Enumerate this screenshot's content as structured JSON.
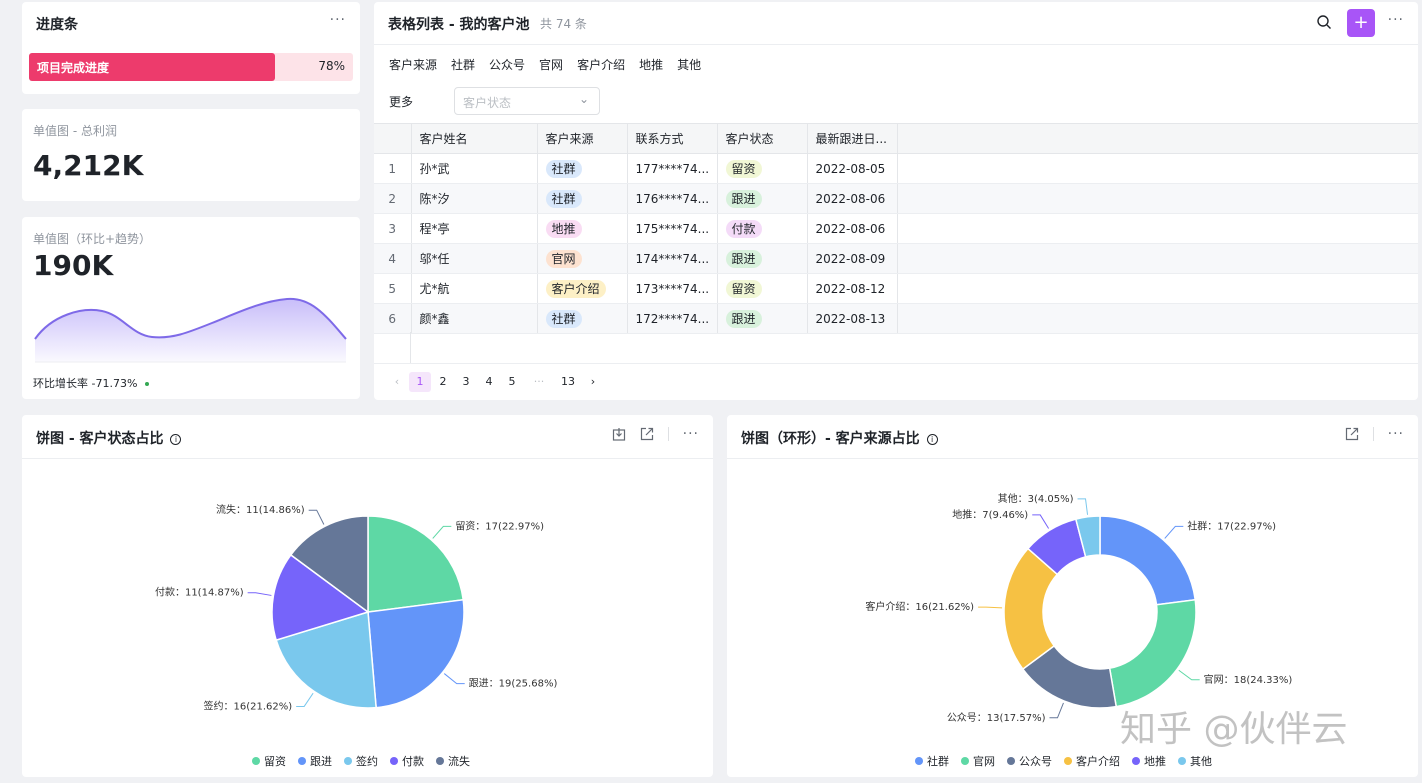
{
  "progress": {
    "title": "进度条",
    "bar_label": "项目完成进度",
    "value_pct": 78,
    "value_text": "78%"
  },
  "profit": {
    "label": "单值图 - 总利润",
    "value": "4,212K"
  },
  "trend": {
    "label": "单值图（环比+趋势）",
    "value": "190K",
    "footer": "环比增长率 -71.73%"
  },
  "table": {
    "title": "表格列表 - 我的客户池",
    "count": "共 74 条",
    "source_label": "客户来源",
    "filters": [
      "社群",
      "公众号",
      "官网",
      "客户介绍",
      "地推",
      "其他"
    ],
    "more_label": "更多",
    "status_placeholder": "客户状态",
    "columns": [
      "客户姓名",
      "客户来源",
      "联系方式",
      "客户状态",
      "最新跟进日..."
    ],
    "rows": [
      {
        "idx": "1",
        "name": "孙*武",
        "source": "社群",
        "phone": "177****74...",
        "status": "留资",
        "date": "2022-08-05"
      },
      {
        "idx": "2",
        "name": "陈*汐",
        "source": "社群",
        "phone": "176****74...",
        "status": "跟进",
        "date": "2022-08-06"
      },
      {
        "idx": "3",
        "name": "程*亭",
        "source": "地推",
        "phone": "175****74...",
        "status": "付款",
        "date": "2022-08-06"
      },
      {
        "idx": "4",
        "name": "邬*任",
        "source": "官网",
        "phone": "174****74...",
        "status": "跟进",
        "date": "2022-08-09"
      },
      {
        "idx": "5",
        "name": "尤*航",
        "source": "客户介绍",
        "phone": "173****74...",
        "status": "留资",
        "date": "2022-08-12"
      },
      {
        "idx": "6",
        "name": "颜*鑫",
        "source": "社群",
        "phone": "172****74...",
        "status": "跟进",
        "date": "2022-08-13"
      }
    ],
    "pager": [
      "1",
      "2",
      "3",
      "4",
      "5",
      "···",
      "13"
    ]
  },
  "chart_data": [
    {
      "type": "pie",
      "title": "饼图 - 客户状态占比",
      "slices": [
        {
          "name": "留资",
          "value": 17,
          "label": "留资：17(22.97%)",
          "color": "#5ed8a5"
        },
        {
          "name": "跟进",
          "value": 19,
          "label": "跟进：19(25.68%)",
          "color": "#6395f9"
        },
        {
          "name": "签约",
          "value": 16,
          "label": "签约：16(21.62%)",
          "color": "#7ac8ed"
        },
        {
          "name": "付款",
          "value": 11,
          "label": "付款：11(14.87%)",
          "color": "#7664fa"
        },
        {
          "name": "流失",
          "value": 11,
          "label": "流失：11(14.86%)",
          "color": "#657798"
        }
      ]
    },
    {
      "type": "pie",
      "title": "饼图（环形）- 客户来源占比",
      "slices": [
        {
          "name": "社群",
          "value": 17,
          "label": "社群：17(22.97%)",
          "color": "#6395f9"
        },
        {
          "name": "官网",
          "value": 18,
          "label": "官网：18(24.33%)",
          "color": "#5ed8a5"
        },
        {
          "name": "公众号",
          "value": 13,
          "label": "公众号：13(17.57%)",
          "color": "#657798"
        },
        {
          "name": "客户介绍",
          "value": 16,
          "label": "客户介绍：16(21.62%)",
          "color": "#f6c143"
        },
        {
          "name": "地推",
          "value": 7,
          "label": "地推：7(9.46%)",
          "color": "#7664fa"
        },
        {
          "name": "其他",
          "value": 3,
          "label": "其他：3(4.05%)",
          "color": "#7ac8ed"
        }
      ]
    }
  ],
  "colors": {
    "progress": "#ed3b6c",
    "accent": "#a855f7",
    "source_tags": {
      "社群": "#d9e8fb",
      "地推": "#f9dcf3",
      "官网": "#fde2d0",
      "客户介绍": "#fdf0c6"
    },
    "status_tags": {
      "留资": "#f1f7d5",
      "跟进": "#d8f1dc",
      "付款": "#f4dbf8"
    }
  },
  "watermark": "知乎 @伙伴云"
}
